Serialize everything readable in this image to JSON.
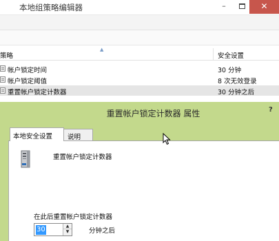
{
  "editor": {
    "title": "本地组策略编辑器",
    "controls": {
      "minimize": "–",
      "close": "✕"
    },
    "columns": {
      "policy": "策略",
      "setting": "安全设置"
    },
    "rows": [
      {
        "name": "帐户锁定时间",
        "value": "30 分钟"
      },
      {
        "name": "帐户锁定阈值",
        "value": "8 次无效登录"
      },
      {
        "name": "重置帐户锁定计数器",
        "value": "30 分钟之后"
      }
    ]
  },
  "dialog": {
    "title": "重置帐户锁定计数器 属性",
    "help": "?",
    "tabs": {
      "local_security": "本地安全设置",
      "explain": "说明"
    },
    "policy_name": "重置帐户锁定计数器",
    "reset_label": "在此后重置帐户锁定计数器",
    "minutes_value": "30",
    "unit_label": "分钟之后",
    "spin_up": "▲",
    "spin_down": "▼"
  },
  "icons": {
    "policy": "policy-document-icon",
    "server": "server-icon",
    "cursor": "mouse-pointer-icon"
  },
  "colors": {
    "dialog_frame": "#c3d98c",
    "close_button": "#c7564c",
    "selection": "#3399ff",
    "selected_row": "#e5e5e5"
  }
}
